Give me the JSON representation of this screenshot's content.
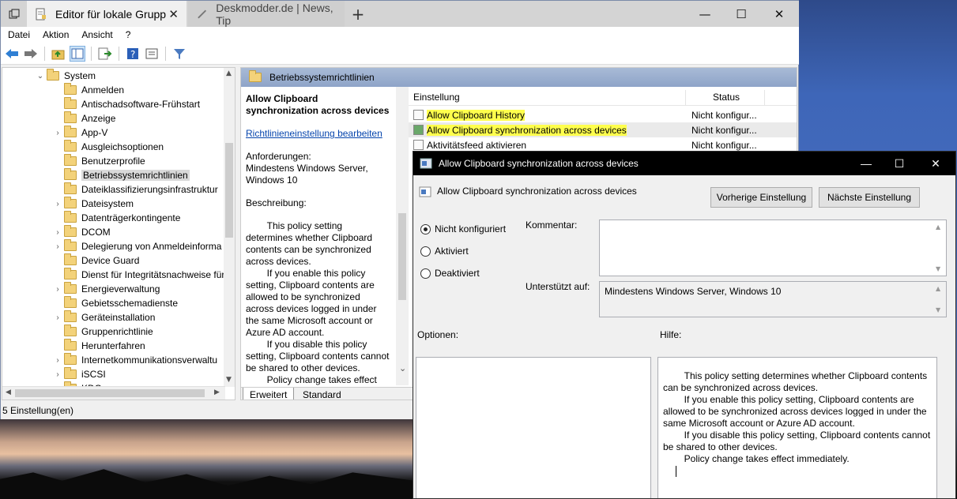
{
  "tabs": {
    "active": "Editor für lokale Grupp",
    "inactive": "Deskmodder.de | News, Tip"
  },
  "window_controls": {
    "minimize": "—",
    "maximize": "☐",
    "close": "✕"
  },
  "menu": [
    "Datei",
    "Aktion",
    "Ansicht",
    "?"
  ],
  "tree": {
    "root": "System",
    "items": [
      "Anmelden",
      "Antischadsoftware-Frühstart",
      "Anzeige",
      "App-V",
      "Ausgleichsoptionen",
      "Benutzerprofile",
      "Betriebssystemrichtlinien",
      "Dateiklassifizierungsinfrastruktur",
      "Dateisystem",
      "Datenträgerkontingente",
      "DCOM",
      "Delegierung von Anmeldeinforma",
      "Device Guard",
      "Dienst für Integritätsnachweise für",
      "Energieverwaltung",
      "Gebietsschemadienste",
      "Geräteinstallation",
      "Gruppenrichtlinie",
      "Herunterfahren",
      "Internetkommunikationsverwaltu",
      "iSCSI",
      "KDC"
    ],
    "expandable": [
      false,
      false,
      false,
      true,
      false,
      false,
      false,
      false,
      true,
      false,
      true,
      true,
      false,
      false,
      true,
      false,
      true,
      false,
      false,
      true,
      true,
      false
    ],
    "selected_index": 6
  },
  "middle": {
    "header": "Betriebssystemrichtlinien",
    "desc_title": "Allow Clipboard synchronization across devices",
    "edit_link": "Richtlinieneinstellung bearbeiten",
    "requirements_label": "Anforderungen:",
    "requirements": "Mindestens Windows Server, Windows 10",
    "description_label": "Beschreibung:",
    "description": "        This policy setting determines whether Clipboard contents can be synchronized across devices.\n        If you enable this policy setting, Clipboard contents are allowed to be synchronized across devices logged in under the same Microsoft account or Azure AD account.\n        If you disable this policy setting, Clipboard contents cannot be shared to other devices.\n        Policy change takes effect",
    "col_setting": "Einstellung",
    "col_status": "Status",
    "rows": [
      {
        "name": "Allow Clipboard History",
        "status": "Nicht konfigur..."
      },
      {
        "name": "Allow Clipboard synchronization across devices",
        "status": "Nicht konfigur..."
      },
      {
        "name": "Aktivitätsfeed aktivieren",
        "status": "Nicht konfigur..."
      }
    ],
    "tab_extended": "Erweitert",
    "tab_standard": "Standard"
  },
  "statusbar": "5 Einstellung(en)",
  "dialog": {
    "title": "Allow Clipboard synchronization across devices",
    "subtitle": "Allow Clipboard synchronization across devices",
    "btn_prev": "Vorherige Einstellung",
    "btn_next": "Nächste Einstellung",
    "radio_not_configured": "Nicht konfiguriert",
    "radio_enabled": "Aktiviert",
    "radio_disabled": "Deaktiviert",
    "comment_label": "Kommentar:",
    "supported_label": "Unterstützt auf:",
    "supported_value": "Mindestens Windows Server, Windows 10",
    "options_label": "Optionen:",
    "help_label": "Hilfe:",
    "help_text": "        This policy setting determines whether Clipboard contents can be synchronized across devices.\n        If you enable this policy setting, Clipboard contents are allowed to be synchronized across devices logged in under the same Microsoft account or Azure AD account.\n        If you disable this policy setting, Clipboard contents cannot be shared to other devices.\n        Policy change takes effect immediately."
  },
  "colors": {
    "highlight": "#ffff4d",
    "link": "#0645ad",
    "header": "#9cb0d0"
  }
}
